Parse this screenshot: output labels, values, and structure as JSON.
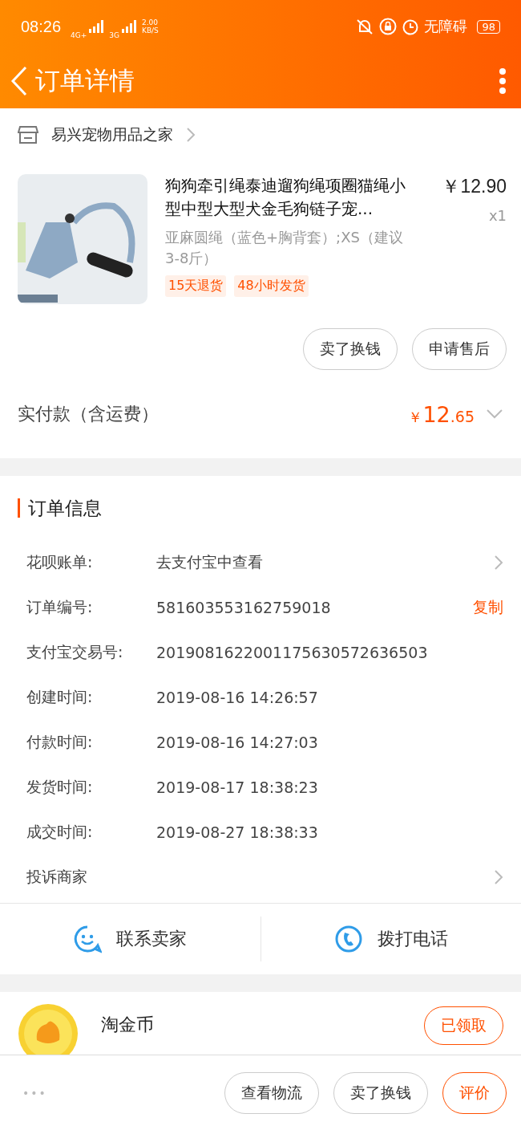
{
  "status_bar": {
    "time": "08:26",
    "network_1": "4G+",
    "network_2": "3G",
    "speed": "2.00",
    "speed_unit": "KB/S",
    "accessibility": "无障碍",
    "battery": "98"
  },
  "header": {
    "title": "订单详情"
  },
  "shop": {
    "name": "易兴宠物用品之家"
  },
  "item": {
    "kind": "picture",
    "title": "狗狗牵引绳泰迪遛狗绳项圈猫绳小型中型大型犬金毛狗链子宠...",
    "price": "￥12.90",
    "quantity": "x1",
    "sku": "亚麻圆绳（蓝色+胸背套）;XS（建议3-8斤）",
    "tags": [
      "15天退货",
      "48小时发货"
    ],
    "buttons": [
      "卖了换钱",
      "申请售后"
    ]
  },
  "payment": {
    "label": "实付款（含运费）",
    "currency": "￥",
    "amount_int": "12",
    "amount_dec": ".65"
  },
  "order_info": {
    "title": "订单信息",
    "rows": [
      {
        "label": "花呗账单:",
        "value": "去支付宝中查看",
        "kind": "link"
      },
      {
        "label": "订单编号:",
        "value": "581603553162759018",
        "kind": "copy",
        "action": "复制"
      },
      {
        "label": "支付宝交易号:",
        "value": "2019081622001175630572636503",
        "kind": "plain"
      },
      {
        "label": "创建时间:",
        "value": "2019-08-16 14:26:57",
        "kind": "plain"
      },
      {
        "label": "付款时间:",
        "value": "2019-08-16 14:27:03",
        "kind": "plain"
      },
      {
        "label": "发货时间:",
        "value": "2019-08-17 18:38:23",
        "kind": "plain"
      },
      {
        "label": "成交时间:",
        "value": "2019-08-27 18:38:33",
        "kind": "plain"
      },
      {
        "label": "投诉商家",
        "kind": "link"
      }
    ]
  },
  "contact": [
    {
      "label": "联系卖家",
      "kind": "chat"
    },
    {
      "label": "拨打电话",
      "kind": "phone"
    }
  ],
  "coins": {
    "title": "淘金币",
    "button": "已领取"
  },
  "bottom_bar": {
    "more": "•••",
    "buttons": [
      {
        "label": "查看物流",
        "kind": "plain"
      },
      {
        "label": "卖了换钱",
        "kind": "plain"
      },
      {
        "label": "评价",
        "kind": "primary"
      }
    ]
  }
}
